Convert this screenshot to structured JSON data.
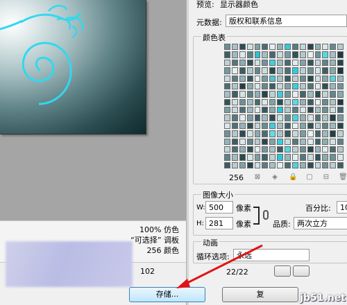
{
  "preview": {
    "view_percent": "100%",
    "dither_mode": "仿色",
    "palette_type": "“可选择” 调板",
    "palette_label": "调板",
    "color_count": "256",
    "colors_label": "颜色",
    "dimension_value": "102",
    "zoom_percent": "100%"
  },
  "settings": {
    "preview_label": "预览:",
    "preview_value": "显示器颜色",
    "metadata_label": "元数据:",
    "metadata_value": "版权和联系信息",
    "color_table_title": "颜色表",
    "color_table_count": "256",
    "swatches": [
      "#6a8f96",
      "#a9c1c6",
      "#2d4f55",
      "#cfe0e2",
      "#7da0a6",
      "#4a6d73",
      "#e6eff0",
      "#93b3b8",
      "#36c9da",
      "#587b81",
      "#c1d6d9",
      "#2a444a",
      "#8fb0b5",
      "#d9e7e9",
      "#668a90",
      "#b5cbcf",
      "#3d6066",
      "#9dbcc1",
      "#dfeaec",
      "#5d8187",
      "#27c3d6",
      "#a3bec3",
      "#476a70",
      "#c7dadd",
      "#799ca2",
      "#30535a",
      "#b0c8cc",
      "#e9f1f2",
      "#6e9298",
      "#4fdbe9",
      "#a6c0c5",
      "#1f3a40",
      "#bfd3d6",
      "#54777d",
      "#8caeb3",
      "#2f4f55",
      "#d2e2e4",
      "#71949a",
      "#3fd0e0",
      "#a0bbc0",
      "#456a70",
      "#e1ecee",
      "#82a4a9",
      "#335459",
      "#c3d7da",
      "#5f8389",
      "#98b6bb",
      "#26454b",
      "#76999f",
      "#e4eef0",
      "#3b5e64",
      "#adc6ca",
      "#62868c",
      "#cbdcdf",
      "#2c4a50",
      "#9ab8bd",
      "#4d7076",
      "#2ecde0",
      "#b9cfd3",
      "#6b8f95",
      "#d6e5e7",
      "#405f65",
      "#87a9ae",
      "#1d363c",
      "#c9dbde",
      "#5a7e84",
      "#93b2b7",
      "#34575d",
      "#e7f0f1",
      "#78999f",
      "#49c6d6",
      "#a8c2c6",
      "#3a5c62",
      "#bccfd3",
      "#6a8e94",
      "#2a484e",
      "#d0e0e2",
      "#85a7ac",
      "#57d6e4",
      "#9cbabf",
      "#4b6e74",
      "#afc7cb",
      "#243f45",
      "#8aabb0",
      "#dde9eb",
      "#65898f",
      "#3c5f65",
      "#c5d8db",
      "#7e9fa5",
      "#33d2e4",
      "#b3cace",
      "#507379",
      "#e0ebed",
      "#2f5056",
      "#98b7bc",
      "#6f9399",
      "#a5bfc4",
      "#3e6167",
      "#d4e3e5",
      "#5c8086",
      "#8db0b5",
      "#284449",
      "#bcd1d4",
      "#47c9da",
      "#729599",
      "#e5eff0",
      "#436669",
      "#9fbcc1",
      "#2e4c52",
      "#c0d4d7",
      "#63878d",
      "#88aaaf",
      "#30535a",
      "#cfdfe1",
      "#6d9197",
      "#a2bdc2",
      "#466a70",
      "#dbe8ea",
      "#81a3a8",
      "#265056",
      "#b7cdd1",
      "#59dbe8",
      "#93b3b8",
      "#3a5d63",
      "#e8f0f1",
      "#688c92",
      "#abc4c8",
      "#21393f",
      "#7b9da3",
      "#c6d9dc",
      "#4c6f75",
      "#9ab8bd",
      "#e2edef",
      "#365960",
      "#8cadb2",
      "#28c4d8",
      "#b2c9cd",
      "#5b7f85",
      "#d8e6e8",
      "#2b494f",
      "#a7c1c5",
      "#6c9096",
      "#cde0e2",
      "#43666c",
      "#b8cdd1",
      "#57797f",
      "#e3edef",
      "#7f9fa5",
      "#3b5d63",
      "#a1bcc1",
      "#2d4b51",
      "#cee0e2",
      "#66898f",
      "#45d4e4",
      "#92b1b6",
      "#d5e3e6",
      "#4f7278",
      "#adc5c9",
      "#253f45",
      "#78999f",
      "#dae8ea",
      "#4e7177",
      "#96b5ba",
      "#2f4d53",
      "#c2d5d8",
      "#6a8d93",
      "#3ecde0",
      "#a4bfc4",
      "#3d6066",
      "#e6eff0",
      "#85a6ab",
      "#324f55",
      "#bacfd3",
      "#60848a",
      "#9fbbc0",
      "#29454b",
      "#6e9298",
      "#b0c8cc",
      "#2a4c52",
      "#d1e1e3",
      "#89aaaf",
      "#4a6d73",
      "#5edde9",
      "#a9c2c6",
      "#37585e",
      "#c7d9dc",
      "#7a9ca2",
      "#e9f1f2",
      "#42656b",
      "#9cb9be",
      "#234046",
      "#bdd1d4",
      "#94b4b9",
      "#3c5e64",
      "#dce9eb",
      "#62868c",
      "#b4cbcf",
      "#2c484e",
      "#81a2a8",
      "#33cfe1",
      "#cadcdf",
      "#55787e",
      "#a0bcc1",
      "#e0ebed",
      "#3f6268",
      "#8badb2",
      "#d3e2e4",
      "#5e8288",
      "#c4d7da",
      "#4d7076",
      "#8fb0b5",
      "#2e4f55",
      "#e4eef0",
      "#74979d",
      "#a8c1c5",
      "#395b61",
      "#52d8e6",
      "#bcd0d3",
      "#6b8f95",
      "#25434a",
      "#9bb9be",
      "#dfeaec",
      "#476a70",
      "#b1c9cd",
      "#5f8389",
      "#a3bec3",
      "#2b4a50",
      "#d7e5e7",
      "#7c9ea4",
      "#3f6167",
      "#bfd3d6",
      "#2bc7da",
      "#98b7bc",
      "#e1ecee",
      "#54777d",
      "#c9dbde",
      "#31525a",
      "#8aacb1",
      "#6d9197",
      "#dbe8ea",
      "#3a5c62",
      "#b6ccd0",
      "#80a2a7",
      "#26454b",
      "#cde0e2",
      "#5a7d83",
      "#a6c0c4",
      "#e7f0f1",
      "#496c72",
      "#4cd3e3",
      "#93b2b7",
      "#2f4e54",
      "#c3d7da",
      "#6f9298",
      "#b9cfd2",
      "#415f65"
    ],
    "image_size_title": "图像大小",
    "width_label": "W:",
    "width_value": "500",
    "height_label": "H:",
    "height_value": "281",
    "pixel_unit": "像素",
    "percent_label": "百分比:",
    "percent_value": "10",
    "quality_label": "品质:",
    "quality_value": "两次立方",
    "animation_title": "动画",
    "loop_label": "循环选项:",
    "loop_value": "永远",
    "frame_counter": "22/22",
    "save_button": "存储...",
    "cancel_button": "复"
  },
  "watermark": "jb51.net"
}
